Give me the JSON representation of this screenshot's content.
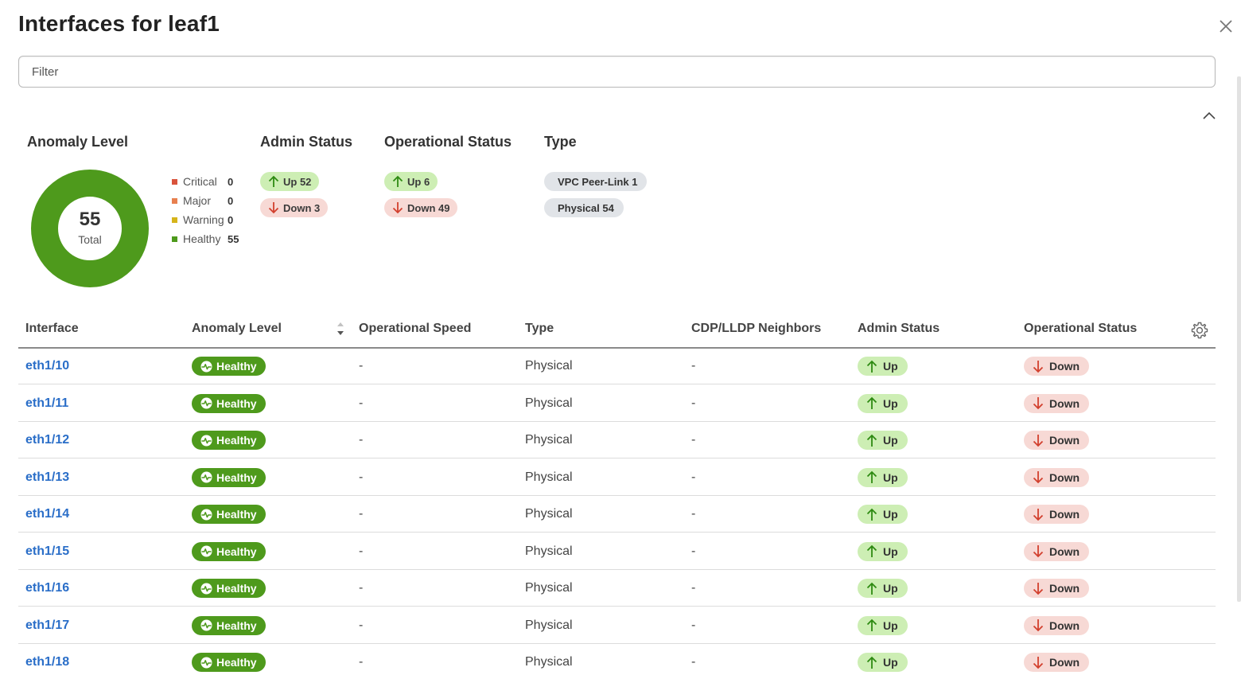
{
  "window": {
    "title": "Interfaces for leaf1"
  },
  "filter": {
    "placeholder": "Filter"
  },
  "summary": {
    "anomaly": {
      "title": "Anomaly Level",
      "total": "55",
      "total_label": "Total",
      "legend": [
        {
          "label": "Critical",
          "count": "0",
          "color": "#d9533c"
        },
        {
          "label": "Major",
          "count": "0",
          "color": "#e8804f"
        },
        {
          "label": "Warning",
          "count": "0",
          "color": "#d6b41a"
        },
        {
          "label": "Healthy",
          "count": "55",
          "color": "#4e9a1c"
        }
      ]
    },
    "admin": {
      "title": "Admin Status",
      "up": "Up 52",
      "down": "Down 3"
    },
    "operational": {
      "title": "Operational Status",
      "up": "Up 6",
      "down": "Down 49"
    },
    "type": {
      "title": "Type",
      "items": [
        "VPC Peer-Link 1",
        "Physical 54"
      ]
    }
  },
  "table": {
    "headers": [
      "Interface",
      "Anomaly Level",
      "Operational Speed",
      "Type",
      "CDP/LLDP Neighbors",
      "Admin Status",
      "Operational Status"
    ],
    "rows": [
      {
        "interface": "eth1/10",
        "anomaly": "Healthy",
        "speed": "-",
        "type": "Physical",
        "cdp": "-",
        "admin": "Up",
        "oper": "Down"
      },
      {
        "interface": "eth1/11",
        "anomaly": "Healthy",
        "speed": "-",
        "type": "Physical",
        "cdp": "-",
        "admin": "Up",
        "oper": "Down"
      },
      {
        "interface": "eth1/12",
        "anomaly": "Healthy",
        "speed": "-",
        "type": "Physical",
        "cdp": "-",
        "admin": "Up",
        "oper": "Down"
      },
      {
        "interface": "eth1/13",
        "anomaly": "Healthy",
        "speed": "-",
        "type": "Physical",
        "cdp": "-",
        "admin": "Up",
        "oper": "Down"
      },
      {
        "interface": "eth1/14",
        "anomaly": "Healthy",
        "speed": "-",
        "type": "Physical",
        "cdp": "-",
        "admin": "Up",
        "oper": "Down"
      },
      {
        "interface": "eth1/15",
        "anomaly": "Healthy",
        "speed": "-",
        "type": "Physical",
        "cdp": "-",
        "admin": "Up",
        "oper": "Down"
      },
      {
        "interface": "eth1/16",
        "anomaly": "Healthy",
        "speed": "-",
        "type": "Physical",
        "cdp": "-",
        "admin": "Up",
        "oper": "Down"
      },
      {
        "interface": "eth1/17",
        "anomaly": "Healthy",
        "speed": "-",
        "type": "Physical",
        "cdp": "-",
        "admin": "Up",
        "oper": "Down"
      },
      {
        "interface": "eth1/18",
        "anomaly": "Healthy",
        "speed": "-",
        "type": "Physical",
        "cdp": "-",
        "admin": "Up",
        "oper": "Down"
      }
    ]
  },
  "icons": {
    "close": "close-icon",
    "collapse": "chevron-up-icon",
    "sort": "sort-icon",
    "settings": "gear-icon",
    "up": "arrow-up-icon",
    "down": "arrow-down-icon",
    "healthy": "heartbeat-icon"
  }
}
